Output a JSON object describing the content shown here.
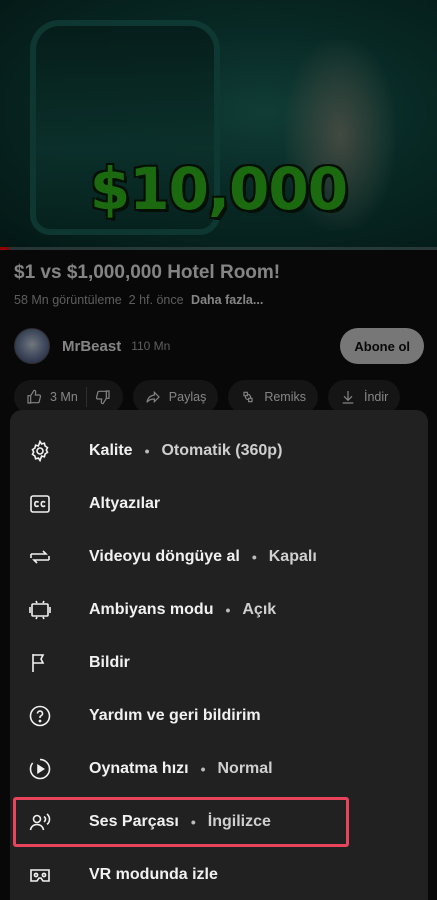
{
  "video": {
    "overlay_text": "$10,000",
    "progress_fraction": 0.02
  },
  "details": {
    "title": "$1 vs $1,000,000 Hotel Room!",
    "views": "58 Mn görüntüleme",
    "age": "2 hf. önce",
    "more": "Daha fazla...",
    "channel_name": "MrBeast",
    "subscribers": "110 Mn",
    "subscribe_label": "Abone ol"
  },
  "actions": {
    "like_count": "3 Mn",
    "share": "Paylaş",
    "remix": "Remiks",
    "download": "İndir"
  },
  "menu": {
    "items": [
      {
        "label": "Kalite",
        "value": "Otomatik (360p)",
        "icon": "gear-icon"
      },
      {
        "label": "Altyazılar",
        "value": "",
        "icon": "captions-icon"
      },
      {
        "label": "Videoyu döngüye al",
        "value": "Kapalı",
        "icon": "loop-icon"
      },
      {
        "label": "Ambiyans modu",
        "value": "Açık",
        "icon": "ambient-mode-icon"
      },
      {
        "label": "Bildir",
        "value": "",
        "icon": "flag-icon"
      },
      {
        "label": "Yardım ve geri bildirim",
        "value": "",
        "icon": "help-icon"
      },
      {
        "label": "Oynatma hızı",
        "value": "Normal",
        "icon": "playback-speed-icon"
      },
      {
        "label": "Ses Parçası",
        "value": "İngilizce",
        "icon": "audio-track-icon"
      },
      {
        "label": "VR modunda izle",
        "value": "",
        "icon": "vr-icon"
      }
    ],
    "separator": "•"
  },
  "colors": {
    "highlight": "#e8455c",
    "sheet_background": "#212121",
    "price_green": "#33c21d"
  }
}
